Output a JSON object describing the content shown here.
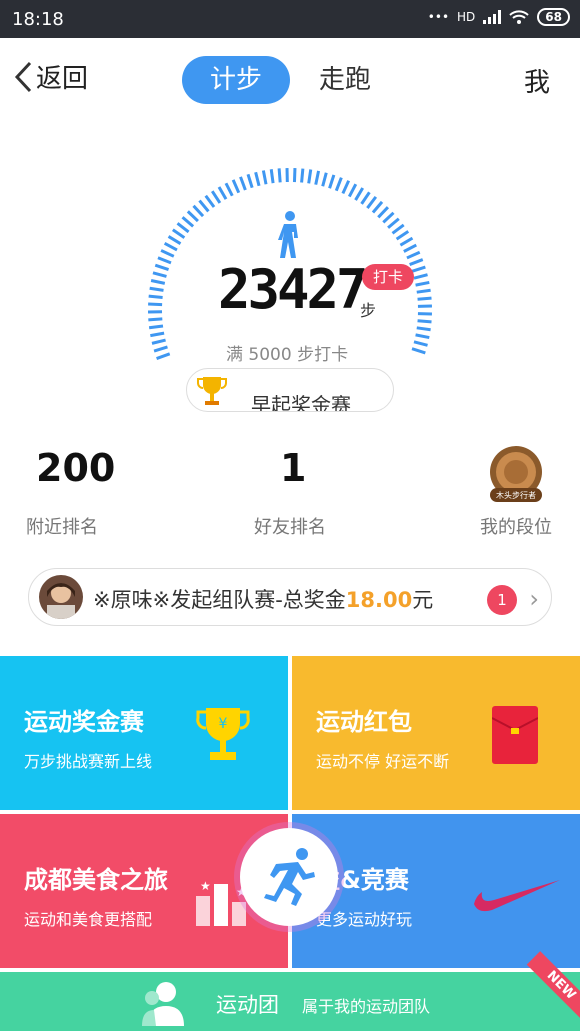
{
  "status_bar": {
    "time": "18:18",
    "network": "HD",
    "battery": "68"
  },
  "nav": {
    "back_label": "返回",
    "tabs": [
      {
        "label": "计步"
      },
      {
        "label": "走跑"
      }
    ],
    "me_label": "我"
  },
  "pedometer": {
    "steps": "23427",
    "unit": "步",
    "checkin_label": "打卡",
    "hint": "满 5000 步打卡",
    "contest_label": "早起奖金赛"
  },
  "stats": {
    "nearby_rank": "200",
    "nearby_label": "附近排名",
    "friend_rank": "1",
    "friend_label": "好友排名",
    "level_label": "我的段位",
    "level_badge_text": "木头步行者"
  },
  "team_banner": {
    "text": "※原味※发起组队赛-总奖金",
    "amount": "18.00",
    "currency": "元",
    "badge_count": "1"
  },
  "tiles": [
    {
      "title": "运动奖金赛",
      "subtitle": "万步挑战赛新上线",
      "color": "#16c3f2"
    },
    {
      "title": "运动红包",
      "subtitle": "运动不停 好运不断",
      "color": "#f8ba2e"
    },
    {
      "title": "成都美食之旅",
      "subtitle": "运动和美食更搭配",
      "color": "#f24c68"
    },
    {
      "title": "益&竞赛",
      "subtitle": "更多运动好玩",
      "color": "#4194ee"
    }
  ],
  "bottom_bar": {
    "title": "运动团",
    "subtitle": "属于我的运动团队",
    "ribbon": "NEW"
  }
}
